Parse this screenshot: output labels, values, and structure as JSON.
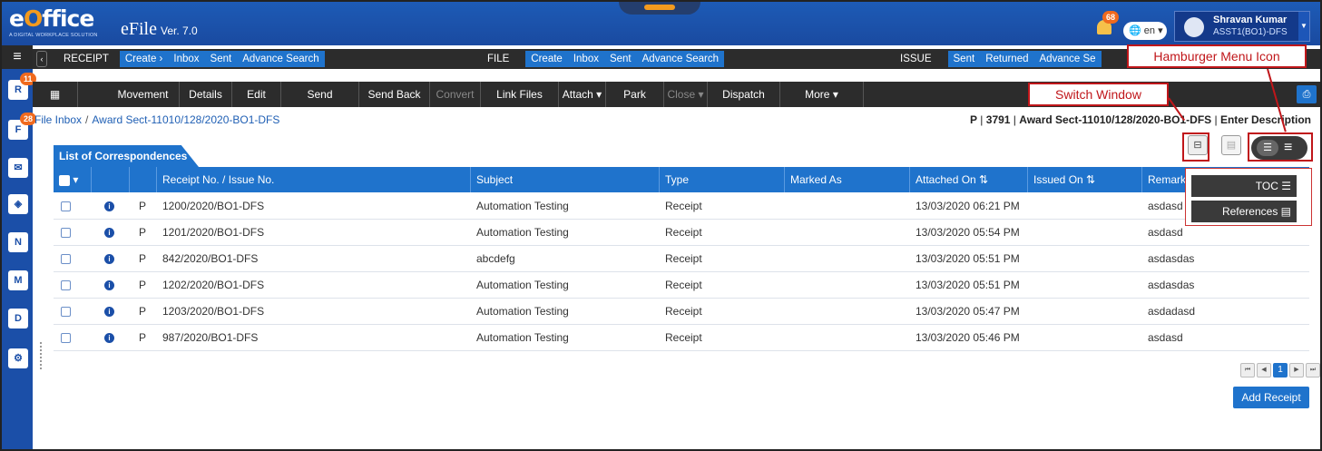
{
  "header": {
    "logo": "eOffice",
    "logo_tagline": "A DIGITAL WORKPLACE SOLUTION",
    "app_name": "eFile",
    "version": "Ver. 7.0",
    "notifications": "68",
    "language": "en",
    "user_name": "Shravan Kumar",
    "user_role": "ASST1(BO1)-DFS"
  },
  "rail": {
    "badge_receipt": "11",
    "badge_file": "28",
    "icons": [
      "receipt-icon",
      "file-icon",
      "mail-icon",
      "dashboard-icon",
      "note-icon",
      "meeting-icon",
      "dsc-icon",
      "settings-icon"
    ]
  },
  "bar1": {
    "receipt": {
      "label": "RECEIPT",
      "items": [
        "Create ›",
        "Inbox",
        "Sent",
        "Advance Search"
      ]
    },
    "file": {
      "label": "FILE",
      "items": [
        "Create",
        "Inbox",
        "Sent",
        "Advance Search"
      ]
    },
    "issue": {
      "label": "ISSUE",
      "items": [
        "Sent",
        "Returned",
        "Advance Se"
      ]
    }
  },
  "toolbar": [
    "Movement",
    "Details",
    "Edit",
    "Send",
    "Send Back",
    "Convert",
    "Link Files",
    "Attach ▾",
    "Park",
    "Close ▾",
    "Dispatch",
    "More ▾"
  ],
  "breadcrumb": {
    "root": "File Inbox",
    "current": "Award Sect-11010/128/2020-BO1-DFS",
    "right_p": "P",
    "right_num": "3791",
    "right_file": "Award Sect-11010/128/2020-BO1-DFS",
    "right_desc": "Enter Description"
  },
  "list": {
    "title": "List of Correspondences",
    "columns": [
      "Receipt No. / Issue No.",
      "Subject",
      "Type",
      "Marked As",
      "Attached On ⇅",
      "Issued On ⇅",
      "Remarks"
    ],
    "rows": [
      {
        "flag": "P",
        "no": "1200/2020/BO1-DFS",
        "subject": "Automation Testing",
        "type": "Receipt",
        "attached": "13/03/2020 06:21 PM",
        "remarks": "asdasd"
      },
      {
        "flag": "P",
        "no": "1201/2020/BO1-DFS",
        "subject": "Automation Testing",
        "type": "Receipt",
        "attached": "13/03/2020 05:54 PM",
        "remarks": "asdasd"
      },
      {
        "flag": "P",
        "no": "842/2020/BO1-DFS",
        "subject": "abcdefg",
        "type": "Receipt",
        "attached": "13/03/2020 05:51 PM",
        "remarks": "asdasdas"
      },
      {
        "flag": "P",
        "no": "1202/2020/BO1-DFS",
        "subject": "Automation Testing",
        "type": "Receipt",
        "attached": "13/03/2020 05:51 PM",
        "remarks": "asdasdas"
      },
      {
        "flag": "P",
        "no": "1203/2020/BO1-DFS",
        "subject": "Automation Testing",
        "type": "Receipt",
        "attached": "13/03/2020 05:47 PM",
        "remarks": "asdadasd"
      },
      {
        "flag": "P",
        "no": "987/2020/BO1-DFS",
        "subject": "Automation Testing",
        "type": "Receipt",
        "attached": "13/03/2020 05:46 PM",
        "remarks": "asdasd"
      }
    ]
  },
  "menu": {
    "toc": "TOC ☰",
    "references": "References ▤"
  },
  "callouts": {
    "hamburger": "Hamburger Menu Icon",
    "switch": "Switch Window"
  },
  "pager": {
    "current": "1"
  },
  "add_receipt": "Add Receipt"
}
